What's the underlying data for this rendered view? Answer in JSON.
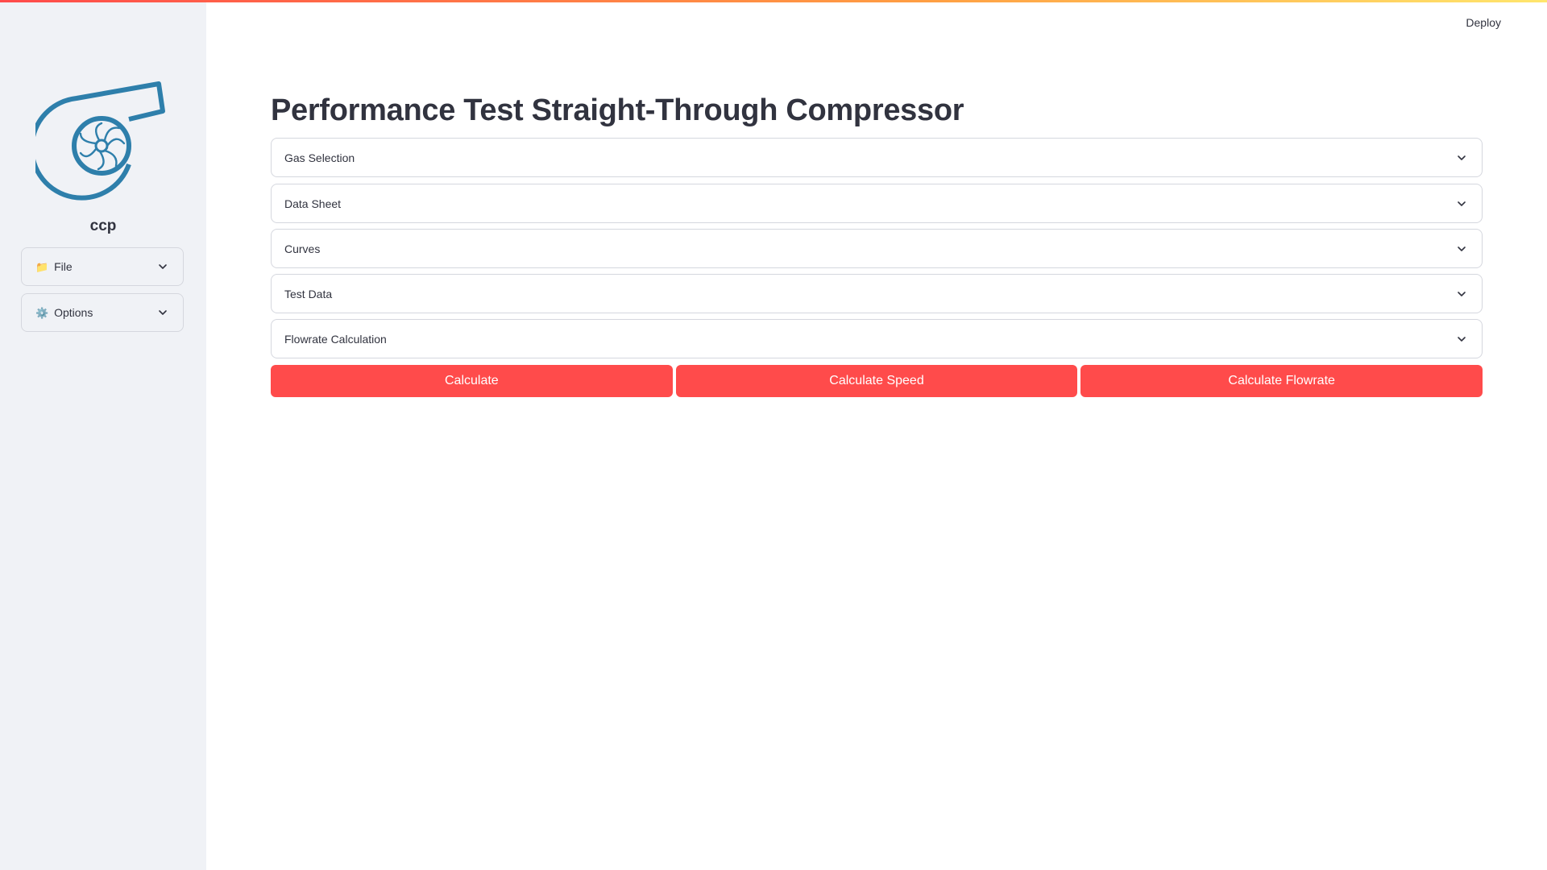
{
  "header": {
    "deploy_label": "Deploy"
  },
  "sidebar": {
    "logo_icon": "compressor-turbine-icon",
    "title": "ccp",
    "expanders": [
      {
        "emoji": "📁",
        "label": "File",
        "icon": "chevron-down-icon"
      },
      {
        "emoji": "⚙️",
        "label": "Options",
        "icon": "chevron-down-icon"
      }
    ]
  },
  "main": {
    "title": "Performance Test Straight-Through Compressor",
    "expanders": [
      {
        "label": "Gas Selection"
      },
      {
        "label": "Data Sheet"
      },
      {
        "label": "Curves"
      },
      {
        "label": "Test Data"
      },
      {
        "label": "Flowrate Calculation"
      }
    ],
    "buttons": [
      {
        "label": "Calculate"
      },
      {
        "label": "Calculate Speed"
      },
      {
        "label": "Calculate Flowrate"
      }
    ]
  },
  "colors": {
    "accent": "#ff4b4b",
    "logo": "#2e7fab",
    "sidebar_bg": "#f0f2f6"
  }
}
